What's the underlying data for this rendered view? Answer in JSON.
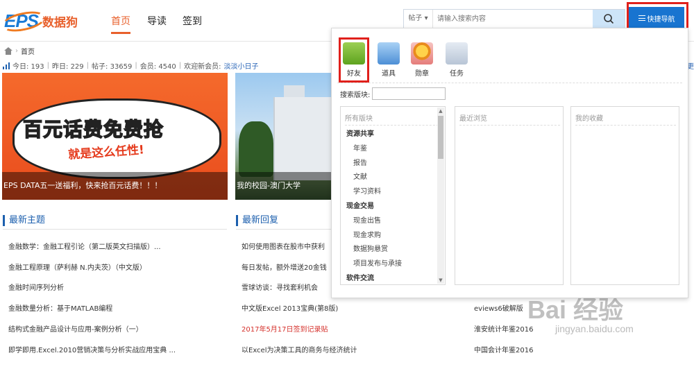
{
  "header": {
    "logo_text": "EPS",
    "logo_cn": "数据狗",
    "nav": [
      "首页",
      "导读",
      "签到"
    ],
    "search_type": "帖子",
    "search_placeholder": "请输入搜索内容",
    "quick_nav": "快捷导航"
  },
  "breadcrumb": {
    "home": "首页"
  },
  "stats": {
    "today": "今日: 193",
    "yesterday": "昨日: 229",
    "posts": "帖子: 33659",
    "members": "会员: 4540",
    "welcome": "欢迎新会员:",
    "new_member": "淡淡小日子"
  },
  "right_edge_text": "更",
  "banners": [
    {
      "title1": "百元话费免费抢",
      "title2": "就是这么任性!",
      "caption": "EPS DATA五一送福利，快来抢百元话费！！！"
    },
    {
      "caption": "我的校园-澳门大学"
    }
  ],
  "sections": {
    "latest": "最新主题",
    "reply": "最新回复"
  },
  "latest_topics": [
    "金融数学：金融工程引论（第二版英文扫描版）...",
    "金融工程原理（萨利赫 N.内夫茨）（中文版）",
    "金融时间序列分析",
    "金融数量分析：基于MATLAB编程",
    "结构式金融产品设计与应用-案例分析（一）",
    "即学即用.Excel.2010营销决策与分析实战应用宝典 ..."
  ],
  "latest_replies": [
    {
      "text": "如何使用图表在股市中获利",
      "red": false
    },
    {
      "text": "每日发帖，额外增送20金钱",
      "red": false
    },
    {
      "text": "雪球访谈：寻找套利机会",
      "red": false
    },
    {
      "text": "中文版Excel 2013宝典(第8版)",
      "red": false
    },
    {
      "text": "2017年5月17日签到记录贴",
      "red": true
    },
    {
      "text": "以Excel为决策工具的商务与经济统计",
      "red": false
    }
  ],
  "third_column": [
    "eviews6破解版",
    "淮安统计年鉴2016",
    "中国会计年鉴2016"
  ],
  "dropdown": {
    "tools": [
      "好友",
      "道具",
      "勋章",
      "任务"
    ],
    "board_search_label": "搜索版块:",
    "columns": {
      "all": "所有版块",
      "recent": "最近浏览",
      "fav": "我的收藏"
    },
    "boards": [
      {
        "type": "cat",
        "label": "资源共享"
      },
      {
        "type": "sub",
        "label": "年鉴"
      },
      {
        "type": "sub",
        "label": "报告"
      },
      {
        "type": "sub",
        "label": "文献"
      },
      {
        "type": "sub",
        "label": "学习资料"
      },
      {
        "type": "cat",
        "label": "现金交易"
      },
      {
        "type": "sub",
        "label": "现金出售"
      },
      {
        "type": "sub",
        "label": "现金求购"
      },
      {
        "type": "sub",
        "label": "数据狗悬赏"
      },
      {
        "type": "sub",
        "label": "项目发布与承接"
      },
      {
        "type": "cat",
        "label": "软件交流"
      }
    ]
  },
  "watermark": {
    "logo": "Bai 经验",
    "url": "jingyan.baidu.com"
  }
}
